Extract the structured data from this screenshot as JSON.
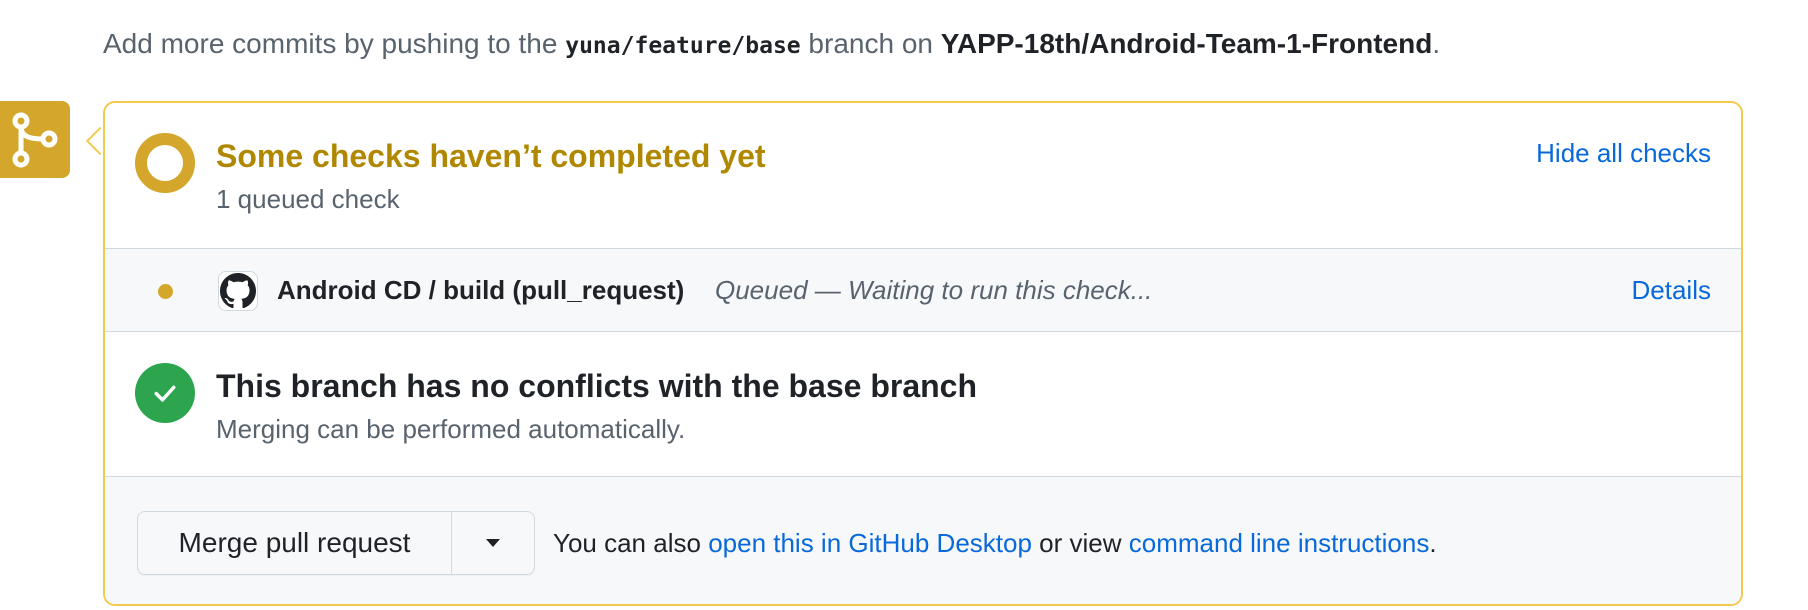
{
  "hint": {
    "prefix": "Add more commits by pushing to the",
    "branch": "yuna/feature/base",
    "middle": "branch on",
    "repo": "YAPP-18th/Android-Team-1-Frontend",
    "suffix": "."
  },
  "checks": {
    "title": "Some checks haven’t completed yet",
    "subtitle": "1 queued check",
    "toggle_label": "Hide all checks",
    "items": [
      {
        "name": "Android CD / build (pull_request)",
        "status": "Queued — Waiting to run this check...",
        "details_label": "Details"
      }
    ]
  },
  "conflicts": {
    "title": "This branch has no conflicts with the base branch",
    "subtitle": "Merging can be performed automatically."
  },
  "merge": {
    "button_label": "Merge pull request",
    "prefix": "You can also",
    "desktop_link": "open this in GitHub Desktop",
    "middle": "or view",
    "cli_link": "command line instructions",
    "suffix": "."
  },
  "colors": {
    "pending": "#d4a72c",
    "pending_title": "#b08800",
    "success": "#2da44e",
    "link": "#0969da",
    "box_border": "#f3c94e"
  },
  "icons": {
    "merge_state": "git-branch-icon",
    "status": "pending-ring-icon",
    "check_app": "github-icon",
    "success": "check-icon",
    "dropdown": "triangle-down-icon"
  }
}
